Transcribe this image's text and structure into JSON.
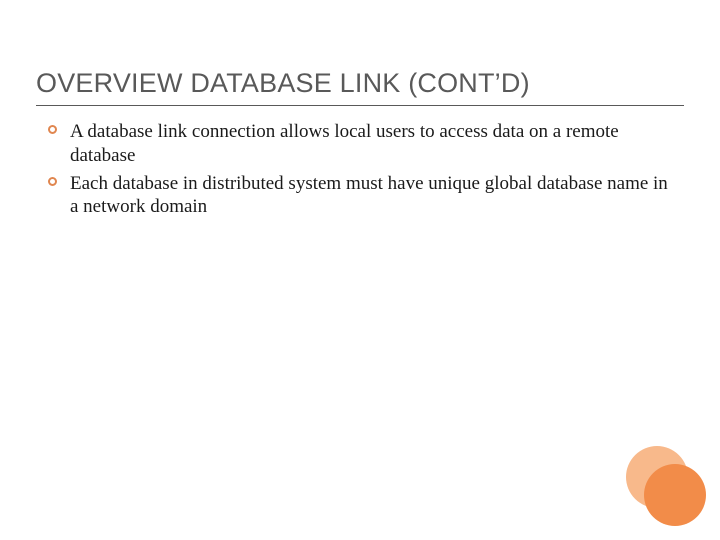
{
  "title": "OVERVIEW DATABASE LINK (CONT’D)",
  "bullets": [
    "A database link connection allows local users to access data on a remote database",
    "Each database in distributed system must have unique global database name in a network domain"
  ],
  "accent_color_light": "#f8b98b",
  "accent_color_dark": "#f28c49"
}
